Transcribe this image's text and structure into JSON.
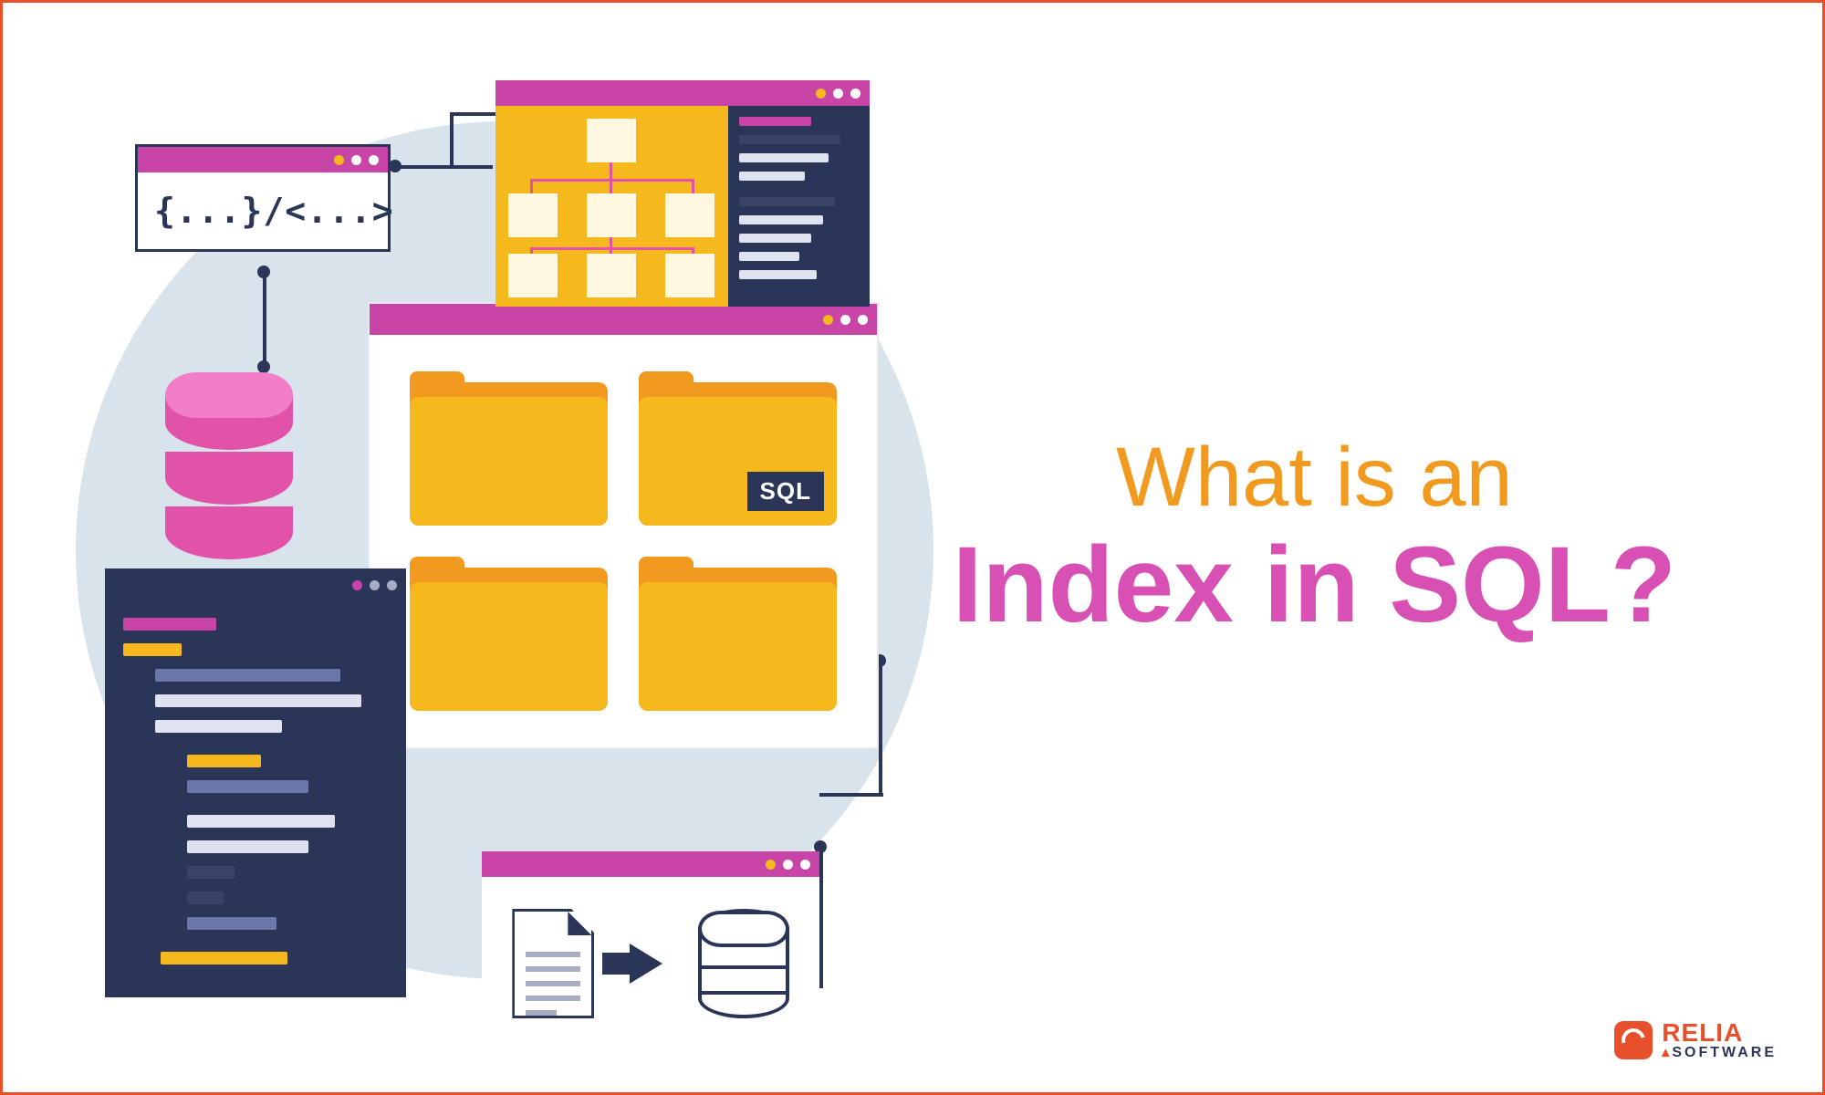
{
  "title": {
    "line1": "What is an",
    "line2": "Index in SQL?"
  },
  "code_snippet": "{...}/<...>",
  "folder_badge": "SQL",
  "logo": {
    "brand": "RELIA",
    "sub": "SOFTWARE"
  },
  "colors": {
    "orange": "#f29a1f",
    "amber": "#f5b81d",
    "magenta": "#c944a7",
    "pink": "#d850b4",
    "navy": "#2b3557",
    "red": "#e8502c"
  }
}
